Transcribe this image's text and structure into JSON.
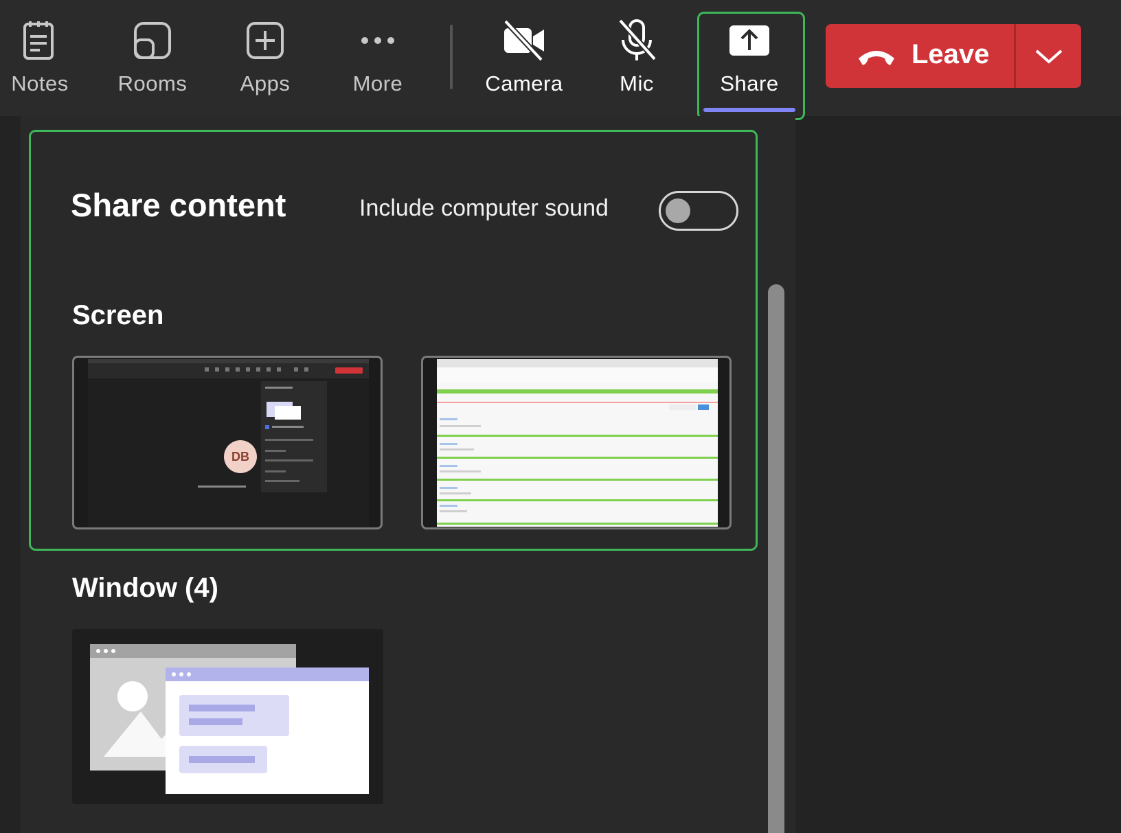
{
  "toolbar": {
    "notes": "Notes",
    "rooms": "Rooms",
    "apps": "Apps",
    "more": "More",
    "camera": "Camera",
    "mic": "Mic",
    "share": "Share",
    "leave": "Leave"
  },
  "share_panel": {
    "title": "Share content",
    "include_sound_label": "Include computer sound",
    "include_sound_on": false,
    "screen_heading": "Screen",
    "screen_thumb_avatar": "DB",
    "window_heading": "Window (4)"
  },
  "colors": {
    "leave_red": "#d13438",
    "accent_purple": "#7f85f5",
    "highlight_green": "#3fb65a"
  }
}
